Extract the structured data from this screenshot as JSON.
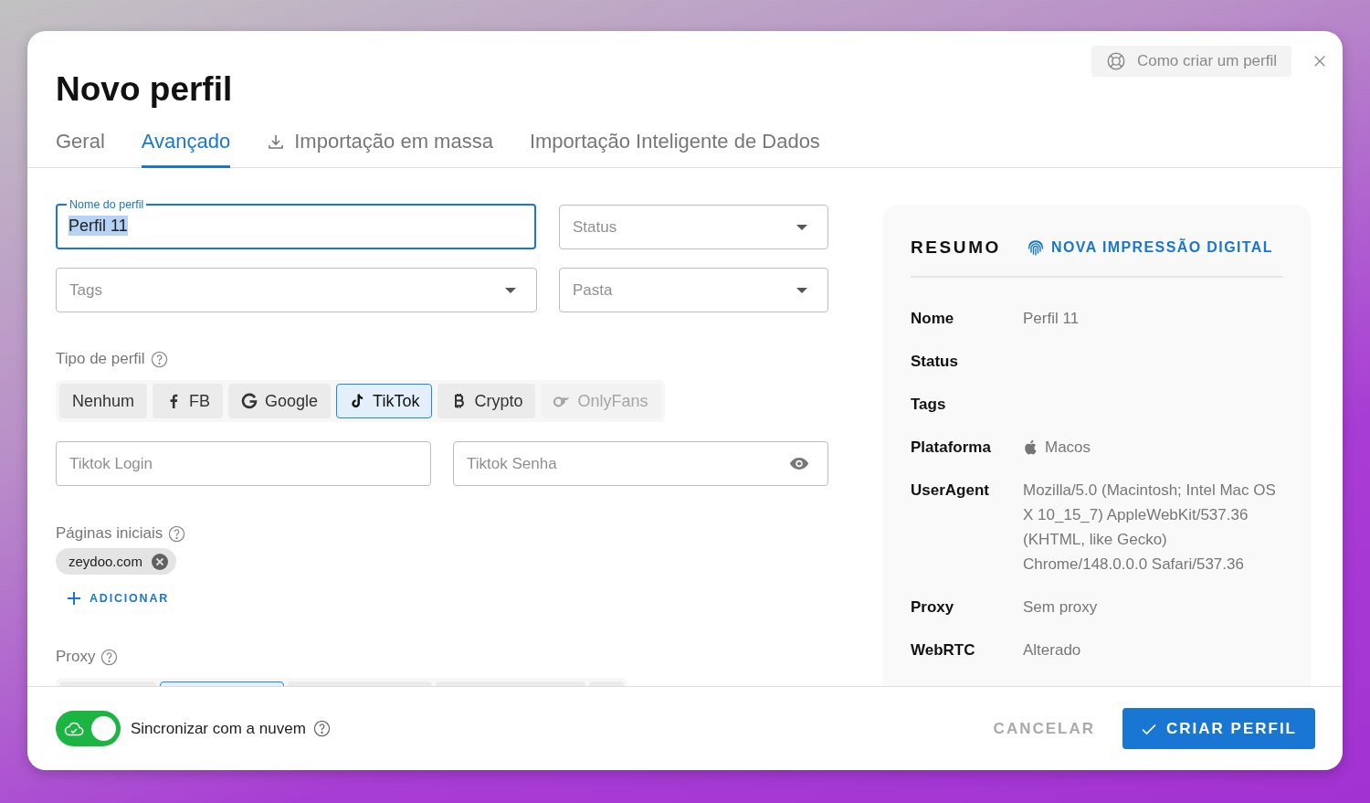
{
  "dialog": {
    "title": "Novo perfil",
    "help_button": "Como criar um perfil"
  },
  "tabs": [
    {
      "label": "Geral",
      "selected": false,
      "kind": "plain"
    },
    {
      "label": "Avançado",
      "selected": true,
      "kind": "plain"
    },
    {
      "label": "Importação em massa",
      "selected": false,
      "kind": "download"
    },
    {
      "label": "Importação Inteligente de Dados",
      "selected": false,
      "kind": "plain"
    }
  ],
  "name_field": {
    "label": "Nome do perfil",
    "value": "Perfil 11",
    "focused": true
  },
  "selects": [
    {
      "placeholder": "Status"
    },
    {
      "placeholder": "Tags"
    },
    {
      "placeholder": "Pasta"
    }
  ],
  "profile_type": {
    "label": "Tipo de perfil",
    "options": [
      {
        "label": "Nenhum",
        "kind": "none",
        "selected": false,
        "disabled": false
      },
      {
        "label": "FB",
        "kind": "facebook",
        "selected": false,
        "disabled": false
      },
      {
        "label": "Google",
        "kind": "google",
        "selected": false,
        "disabled": false
      },
      {
        "label": "TikTok",
        "kind": "tiktok",
        "selected": true,
        "disabled": false
      },
      {
        "label": "Crypto",
        "kind": "bitcoin",
        "selected": false,
        "disabled": false
      },
      {
        "label": "OnlyFans",
        "kind": "onlyfans",
        "selected": false,
        "disabled": true
      }
    ]
  },
  "credentials": {
    "login_placeholder": "Tiktok Login",
    "password_placeholder": "Tiktok Senha"
  },
  "start_pages": {
    "label": "Páginas iniciais",
    "chips": [
      "zeydoo.com"
    ],
    "add_button": "ADICIONAR"
  },
  "proxy": {
    "label": "Proxy",
    "options": [
      {
        "selected": false
      },
      {
        "selected": true
      },
      {
        "selected": false
      },
      {
        "selected": false
      },
      {
        "selected": false
      }
    ]
  },
  "summary": {
    "title": "RESUMO",
    "fingerprint_button": "NOVA IMPRESSÃO DIGITAL",
    "rows": [
      {
        "label": "Nome",
        "value": "Perfil 11",
        "kind": "text"
      },
      {
        "label": "Status",
        "kind": "text"
      },
      {
        "label": "Tags",
        "kind": "text"
      },
      {
        "label": "Plataforma",
        "value": "Macos",
        "kind": "platform"
      },
      {
        "label": "UserAgent",
        "value": "Mozilla/5.0 (Macintosh; Intel Mac OS X 10_15_7) AppleWebKit/537.36 (KHTML, like Gecko) Chrome/148.0.0.0 Safari/537.36",
        "kind": "text"
      },
      {
        "label": "Proxy",
        "value": "Sem proxy",
        "kind": "text"
      },
      {
        "label": "WebRTC",
        "value": "Alterado",
        "kind": "text"
      }
    ]
  },
  "footer": {
    "sync": {
      "label": "Sincronizar com a nuvem",
      "on": true
    },
    "cancel": "CANCELAR",
    "create": "CRIAR PERFIL"
  }
}
